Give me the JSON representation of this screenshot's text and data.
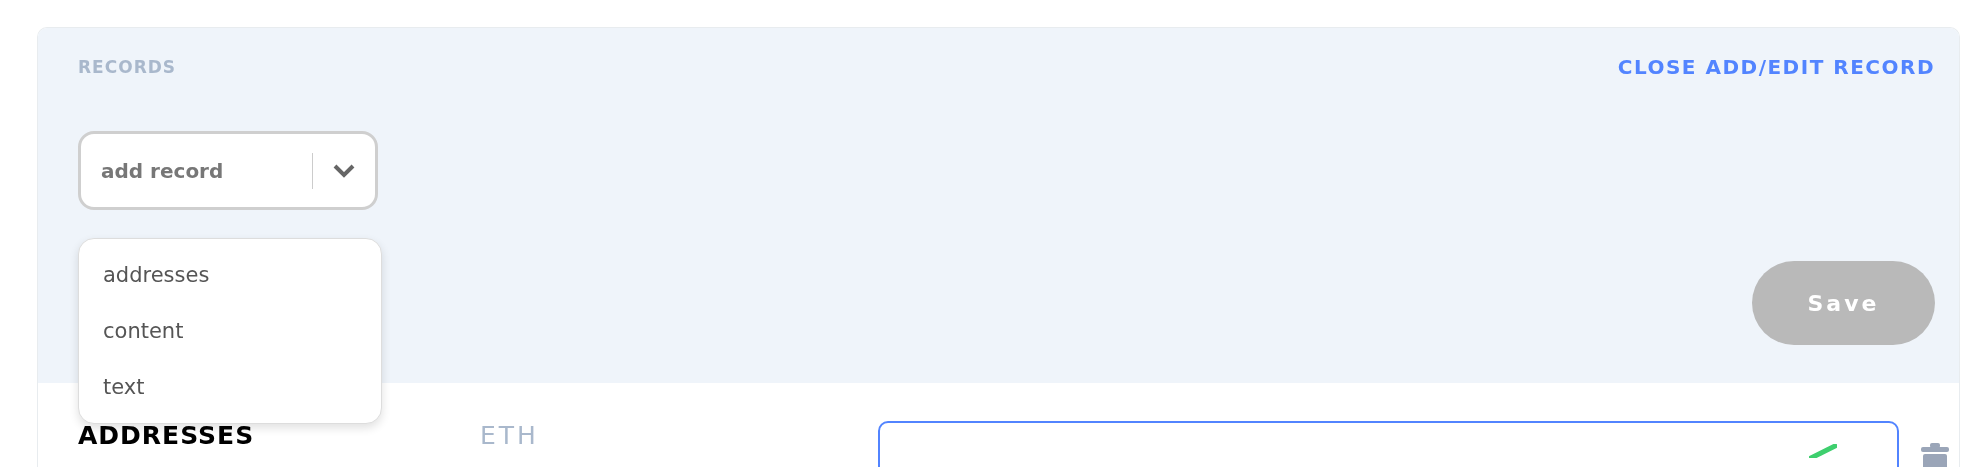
{
  "header": {
    "title": "RECORDS",
    "close_link": "CLOSE ADD/EDIT RECORD"
  },
  "record_select": {
    "placeholder": "add record",
    "open": true,
    "options": [
      {
        "label": "addresses",
        "selected": false
      },
      {
        "label": "content",
        "selected": false
      },
      {
        "label": "text",
        "selected": false
      }
    ]
  },
  "save_button": {
    "label": "Save",
    "disabled": true
  },
  "rows": [
    {
      "section": "ADDRESSES",
      "coin": "ETH",
      "valid": true
    }
  ]
}
